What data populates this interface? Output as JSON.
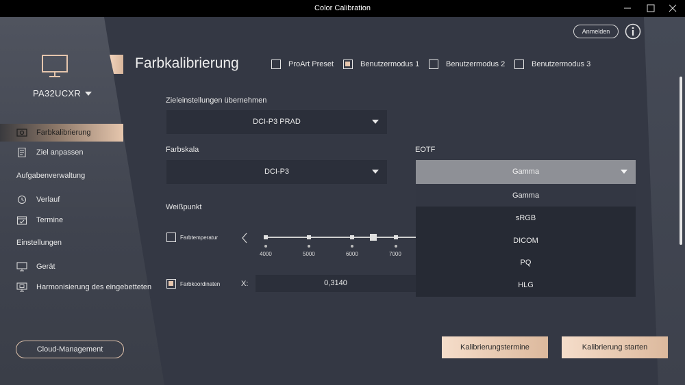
{
  "window": {
    "title": "Color Calibration"
  },
  "sidebar": {
    "model": "PA32UCXR",
    "items": [
      {
        "label": "Farbkalibrierung",
        "icon": "camera-icon",
        "active": true
      },
      {
        "label": "Ziel anpassen",
        "icon": "document-icon",
        "active": false
      }
    ],
    "section_tasks": "Aufgabenverwaltung",
    "task_items": [
      {
        "label": "Verlauf",
        "icon": "history-icon"
      },
      {
        "label": "Termine",
        "icon": "calendar-icon"
      }
    ],
    "section_settings": "Einstellungen",
    "settings_items": [
      {
        "label": "Gerät",
        "icon": "monitor-icon"
      },
      {
        "label": "Harmonisierung des eingebetteten",
        "icon": "embedded-monitor-icon"
      }
    ],
    "cloud_button": "Cloud-Management"
  },
  "header": {
    "title": "Farbkalibrierung",
    "modes": [
      {
        "label": "ProArt Preset",
        "checked": false
      },
      {
        "label": "Benutzermodus 1",
        "checked": true
      },
      {
        "label": "Benutzermodus 2",
        "checked": false
      },
      {
        "label": "Benutzermodus 3",
        "checked": false
      }
    ],
    "login_button": "Anmelden"
  },
  "form": {
    "target_label": "Zieleinstellungen übernehmen",
    "target_value": "DCI-P3 PRAD",
    "gamut_label": "Farbskala",
    "gamut_value": "DCI-P3",
    "eotf_label": "EOTF",
    "eotf_value": "Gamma",
    "eotf_options": [
      "Gamma",
      "sRGB",
      "DICOM",
      "PQ",
      "HLG"
    ],
    "whitepoint_label": "Weißpunkt",
    "color_temp_label": "Farbtemperatur",
    "color_temp_checked": false,
    "temp_ticks": [
      "4000",
      "5000",
      "6000",
      "7000"
    ],
    "coords_label": "Farbkoordinaten",
    "coords_checked": true,
    "x_label": "X:",
    "x_value": "0,3140"
  },
  "actions": {
    "schedule_button": "Kalibrierungstermine",
    "start_button": "Kalibrierung starten"
  },
  "colors": {
    "accent": "#e6c6ad",
    "background": "#343844",
    "field": "#2b2f3a"
  }
}
